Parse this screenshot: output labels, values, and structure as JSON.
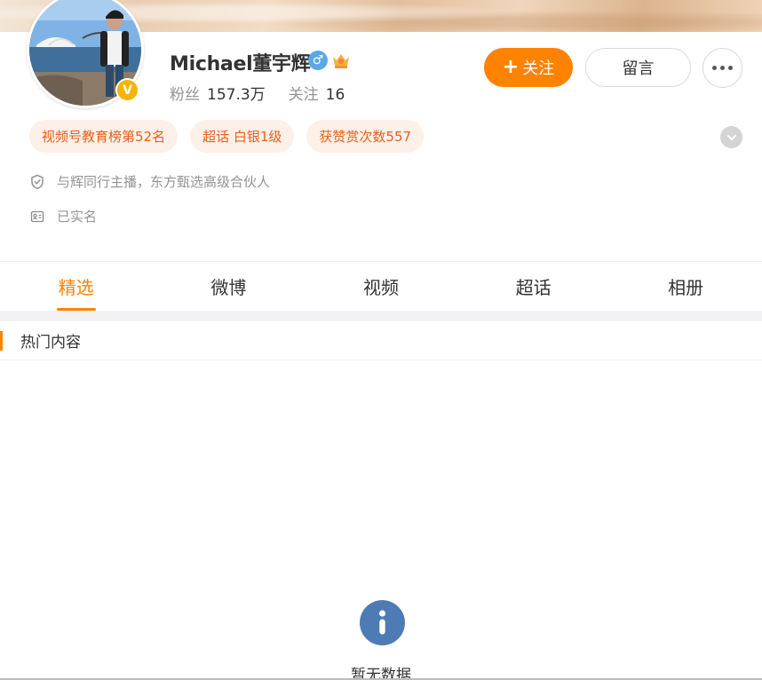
{
  "profile": {
    "name": "Michael董宇辉",
    "verified_badge": "V",
    "gender_symbol": "♂",
    "followers_label": "粉丝",
    "followers_value": "157.3万",
    "following_label": "关注",
    "following_value": "16"
  },
  "actions": {
    "follow_plus": "+",
    "follow_label": "关注",
    "message_label": "留言"
  },
  "tags": [
    "视频号教育榜第52名",
    "超话 白银1级",
    "获赞赏次数557"
  ],
  "info": {
    "bio": "与辉同行主播，东方甄选高级合伙人",
    "real_name": "已实名"
  },
  "tabs": [
    "精选",
    "微博",
    "视频",
    "超话",
    "相册"
  ],
  "section": {
    "title": "热门内容"
  },
  "empty_state": {
    "text": "暂无数据"
  },
  "colors": {
    "accent": "#ff8200",
    "tag_text": "#e8601d",
    "tag_bg": "#fdf0e8",
    "gender": "#5aa9e6",
    "verify": "#f5b400",
    "empty_icon": "#4f7bb4"
  },
  "icons": {
    "more": "more-dots-icon",
    "expand": "chevron-down-icon",
    "bio": "shield-icon",
    "real_name": "id-card-icon",
    "empty": "info-icon",
    "vip": "crown-icon"
  }
}
